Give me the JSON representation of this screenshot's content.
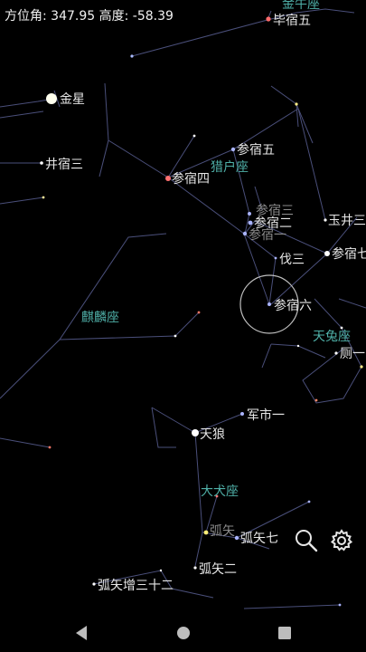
{
  "status": {
    "azimuth_label": "方位角:",
    "azimuth_value": "347.95",
    "altitude_label": "高度:",
    "altitude_value": "-58.39"
  },
  "stars": [
    {
      "label": "毕宿五"
    },
    {
      "label": "金星"
    },
    {
      "label": "井宿三"
    },
    {
      "label": "参宿五"
    },
    {
      "label": "参宿四"
    },
    {
      "label": "参宿三"
    },
    {
      "label": "参宿二"
    },
    {
      "label": "参宿一"
    },
    {
      "label": "玉井三"
    },
    {
      "label": "参宿七"
    },
    {
      "label": "伐三"
    },
    {
      "label": "参宿六"
    },
    {
      "label": "厕一"
    },
    {
      "label": "军市一"
    },
    {
      "label": "天狼"
    },
    {
      "label": "弧矢"
    },
    {
      "label": "弧矢七"
    },
    {
      "label": "弧矢二"
    },
    {
      "label": "弧矢增三十二"
    }
  ],
  "constellations": [
    {
      "label": "金牛座"
    },
    {
      "label": "猎户座"
    },
    {
      "label": "麒麟座"
    },
    {
      "label": "天兔座"
    },
    {
      "label": "大犬座"
    }
  ],
  "colors": {
    "line": "#4a4f7a",
    "constellation": "#4fb0a8",
    "sky": "#000000",
    "text": "#e6e6e6"
  },
  "toolbar": {
    "search_icon": "search-icon",
    "settings_icon": "gear-icon"
  },
  "nav": {
    "back_icon": "back-triangle-icon",
    "home_icon": "home-circle-icon",
    "recents_icon": "recents-square-icon"
  }
}
